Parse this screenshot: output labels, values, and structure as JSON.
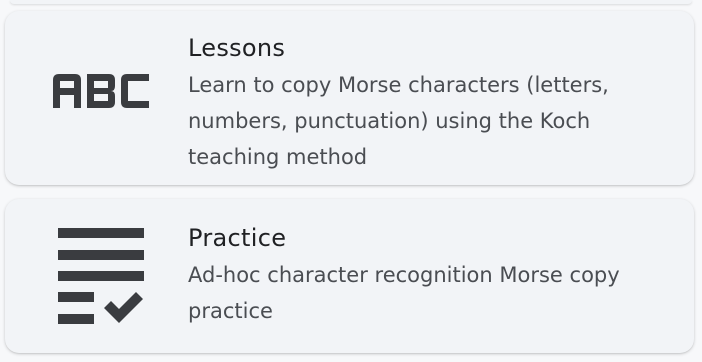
{
  "items": [
    {
      "title": "Lessons",
      "description": "Learn to copy Morse characters (letters, numbers, punctuation) using the Koch teaching method",
      "icon": "abc-icon"
    },
    {
      "title": "Practice",
      "description": "Ad-hoc character recognition Morse copy practice",
      "icon": "checklist-icon"
    }
  ],
  "colors": {
    "card_background": "#f2f4f7",
    "icon": "#3a3c40",
    "title": "#202124",
    "description": "#4a4d52"
  }
}
